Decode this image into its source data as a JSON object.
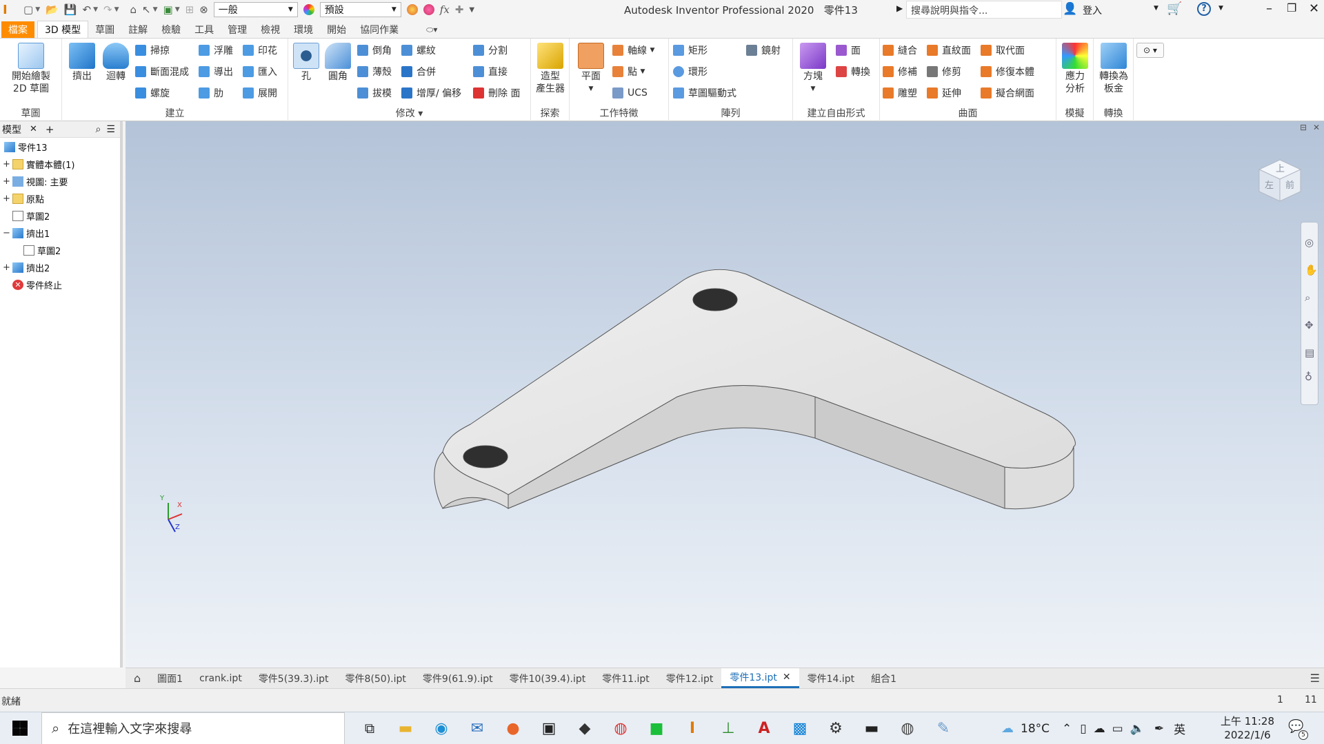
{
  "titlebar": {
    "style_combo": "一般",
    "appearance_combo": "預設",
    "fx": "fx",
    "app_title": "Autodesk Inventor Professional 2020",
    "doc_name": "零件13",
    "help_search_placeholder": "搜尋說明與指令...",
    "login": "登入"
  },
  "ribbon_tabs": [
    "檔案",
    "3D 模型",
    "草圖",
    "註解",
    "檢驗",
    "工具",
    "管理",
    "檢視",
    "環境",
    "開始",
    "協同作業"
  ],
  "ribbon": {
    "sketch": {
      "start_sketch": "開始繪製",
      "start_sketch2": "2D 草圖",
      "group": "草圖"
    },
    "create": {
      "extrude": "擠出",
      "revolve": "迴轉",
      "sweep": "掃掠",
      "loft": "斷面混成",
      "coil": "螺旋",
      "emboss": "浮雕",
      "derive": "導出",
      "rib": "肋",
      "decal": "印花",
      "import": "匯入",
      "unwrap": "展開",
      "group": "建立"
    },
    "modify": {
      "hole": "孔",
      "fillet": "圓角",
      "chamfer": "倒角",
      "shell": "薄殼",
      "draft": "拔模",
      "thread": "螺紋",
      "combine": "合併",
      "thicken": "增厚/ 偏移",
      "split": "分割",
      "direct": "直接",
      "delete_face": "刪除 面",
      "group": "修改"
    },
    "explore": {
      "shape_gen1": "造型",
      "shape_gen2": "產生器",
      "group": "探索"
    },
    "work": {
      "plane": "平面",
      "axis": "軸線",
      "point": "點",
      "ucs": "UCS",
      "group": "工作特徵"
    },
    "pattern": {
      "rect": "矩形",
      "circ": "環形",
      "sketch_driven": "草圖驅動式",
      "mirror": "鏡射",
      "group": "陣列"
    },
    "freeform": {
      "box": "方塊",
      "face": "面",
      "convert": "轉換",
      "group": "建立自由形式"
    },
    "surface": {
      "stitch": "縫合",
      "patch": "修補",
      "sculpt": "雕塑",
      "ruled": "直紋面",
      "trim": "修剪",
      "extend": "延伸",
      "replace": "取代面",
      "repair": "修復本體",
      "fit_mesh": "擬合網面",
      "group": "曲面"
    },
    "simulation": {
      "stress1": "應力",
      "stress2": "分析",
      "group": "模擬"
    },
    "convert": {
      "sheet1": "轉換為",
      "sheet2": "板金",
      "group": "轉換"
    }
  },
  "browser": {
    "tab": "模型",
    "items": [
      {
        "label": "零件13",
        "level": 0,
        "exp": ""
      },
      {
        "label": "實體本體(1)",
        "level": 1,
        "exp": "+"
      },
      {
        "label": "視圖: 主要",
        "level": 1,
        "exp": "+"
      },
      {
        "label": "原點",
        "level": 1,
        "exp": "+"
      },
      {
        "label": "草圖2",
        "level": 1,
        "exp": ""
      },
      {
        "label": "擠出1",
        "level": 1,
        "exp": "−"
      },
      {
        "label": "草圖2",
        "level": 2,
        "exp": ""
      },
      {
        "label": "擠出2",
        "level": 1,
        "exp": "+"
      },
      {
        "label": "零件終止",
        "level": 1,
        "exp": ""
      }
    ]
  },
  "viewcube": {
    "top": "上",
    "front": "前",
    "left": "左"
  },
  "triad": {
    "x": "X",
    "y": "Y",
    "z": "Z"
  },
  "doc_tabs": [
    "圖面1",
    "crank.ipt",
    "零件5(39.3).ipt",
    "零件8(50).ipt",
    "零件9(61.9).ipt",
    "零件10(39.4).ipt",
    "零件11.ipt",
    "零件12.ipt",
    "零件13.ipt",
    "零件14.ipt",
    "組合1"
  ],
  "doc_tabs_active": 8,
  "status": {
    "text": "就緒",
    "n1": "1",
    "n2": "11"
  },
  "taskbar": {
    "search_placeholder": "在這裡輸入文字來搜尋",
    "temperature": "18°C",
    "ime": "英",
    "time": "上午 11:28",
    "date": "2022/1/6",
    "notif_count": "5"
  }
}
